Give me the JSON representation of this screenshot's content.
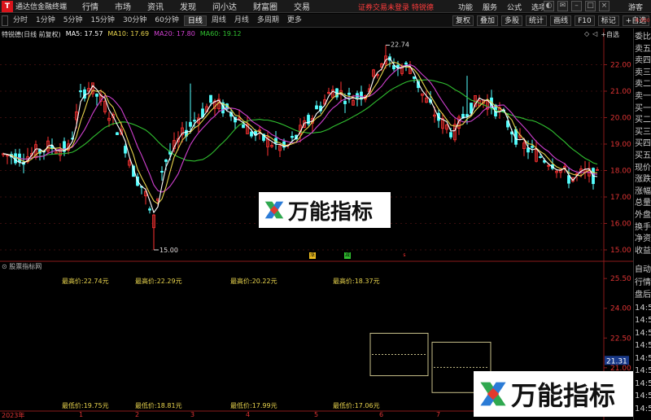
{
  "app": {
    "title": "通达信金融终端",
    "menu": [
      "行情",
      "市场",
      "资讯",
      "发现",
      "问小达",
      "财富圈",
      "交易"
    ],
    "notice": "证券交易未登录  特锐德",
    "tools": [
      "功能",
      "服务",
      "公式",
      "选项"
    ],
    "guest": "游客"
  },
  "toolbar": {
    "periods": [
      "分时",
      "1分钟",
      "5分钟",
      "15分钟",
      "30分钟",
      "60分钟",
      "日线",
      "周线",
      "月线",
      "多周期",
      "更多"
    ],
    "active_period": "日线",
    "right_buttons": [
      "复权",
      "叠加",
      "多股",
      "统计",
      "画线",
      "F10",
      "标记",
      "+自选",
      "返回"
    ]
  },
  "chart": {
    "stock_label": "特锐德(日线 前复权)",
    "ma5": "MA5: 17.57",
    "ma10": "MA10: 17.69",
    "ma20": "MA20: 17.80",
    "ma60": "MA60: 19.12",
    "right_tools": [
      "◇",
      "◁",
      "+自选"
    ],
    "price_ticks": [
      "22.00",
      "21.00",
      "20.00",
      "19.00",
      "18.00",
      "17.00",
      "16.00",
      "15.00"
    ],
    "high_marker": "22.74",
    "low_marker": "15.00",
    "colors": {
      "up": "#ff3232",
      "down": "#54ffff",
      "ma5": "#ffffff",
      "ma10": "#e8d44d",
      "ma20": "#d040d0",
      "ma60": "#30c030"
    }
  },
  "indicator": {
    "title": "股票指标网",
    "high_labels": [
      "最高价:22.74元",
      "最高价:22.29元",
      "最高价:20.22元",
      "最高价:18.37元"
    ],
    "low_labels": [
      "最低价:19.75元",
      "最低价:18.81元",
      "最低价:17.99元",
      "最低价:17.06元"
    ],
    "axis_ticks": [
      "25.50",
      "24.00",
      "22.50",
      "21.00",
      "19.50"
    ],
    "current_value": "21.31"
  },
  "sidepanel": {
    "top_label": "R 500",
    "items_top": [
      "委比",
      "卖五",
      "卖四",
      "卖三",
      "卖二",
      "卖一",
      "买一",
      "买二",
      "买三",
      "买四",
      "买五",
      "现价",
      "涨跌",
      "涨幅",
      "总量",
      "外盘",
      "换手",
      "净资",
      "收益"
    ],
    "items_bottom": [
      "自动",
      "行情",
      "盘后",
      "14:5",
      "14:5",
      "14:5",
      "14:5",
      "14:5",
      "14:5",
      "14:5",
      "14:5",
      "14:5"
    ]
  },
  "time_axis": {
    "year": "2023年",
    "ticks": [
      "1",
      "2",
      "3",
      "4",
      "5",
      "6",
      "7",
      "8",
      "9"
    ]
  },
  "watermark": {
    "text": "万能指标"
  },
  "badges": [
    "涨",
    "减",
    "s"
  ]
}
